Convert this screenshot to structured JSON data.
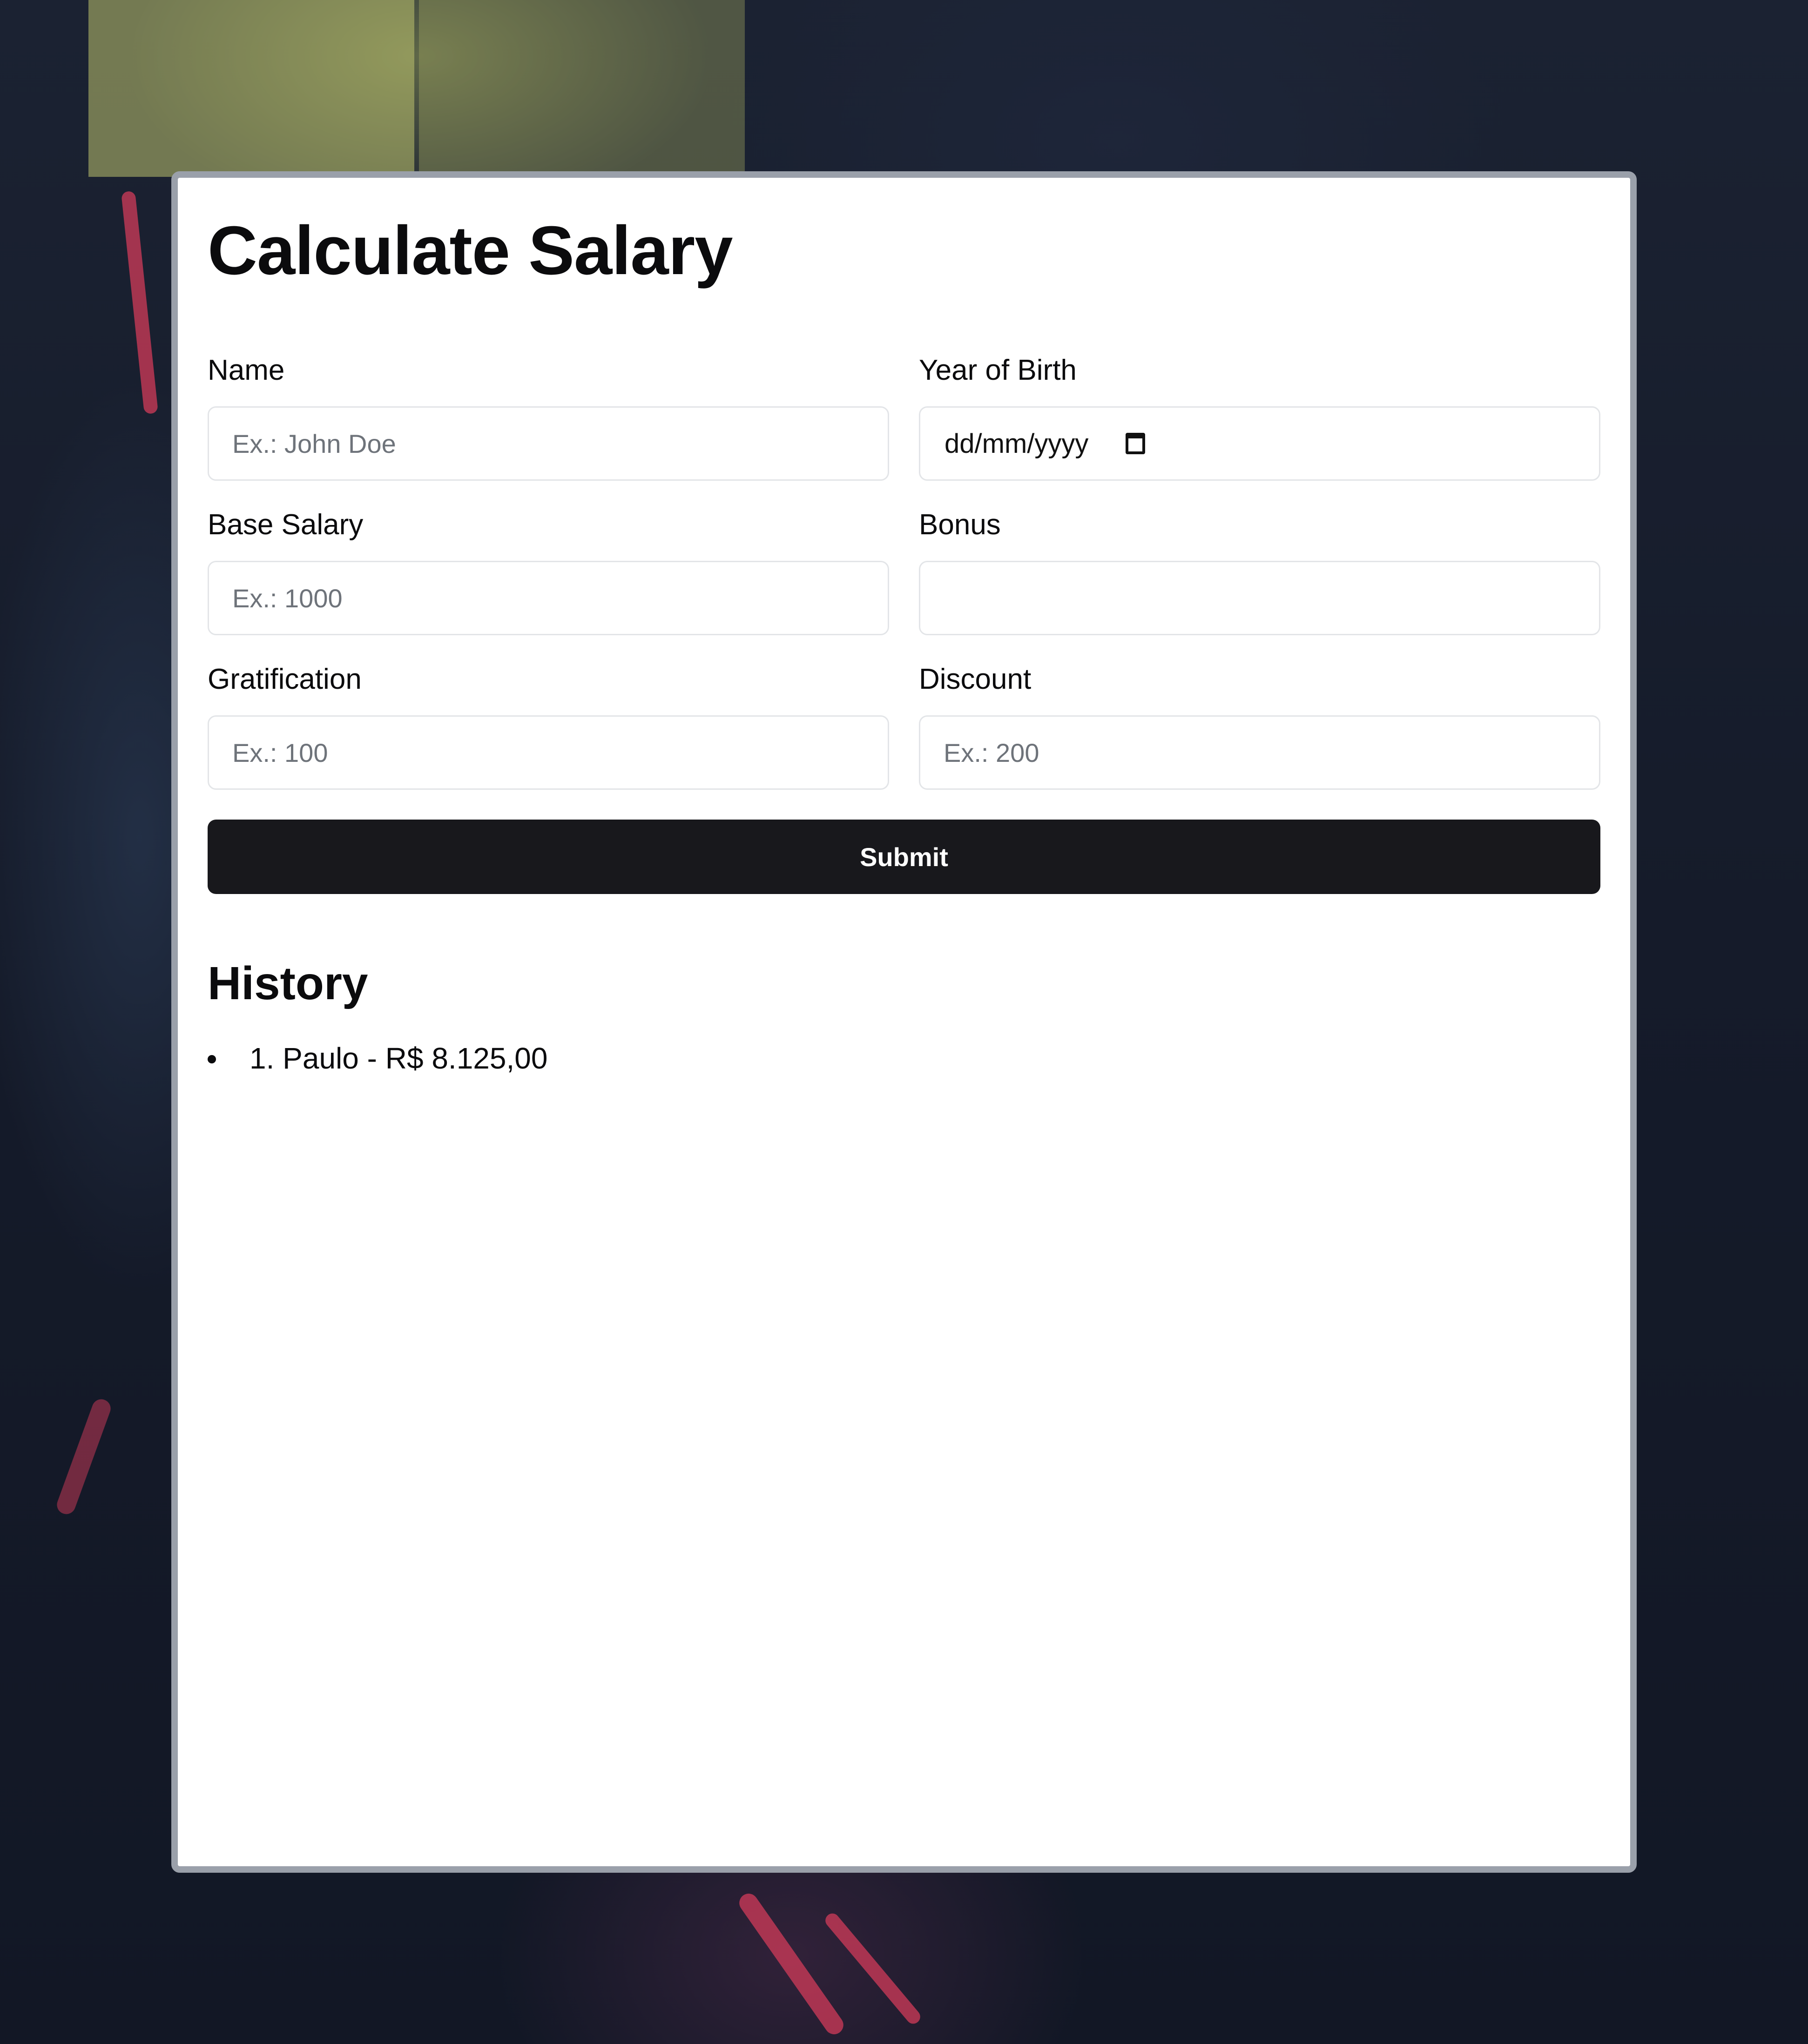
{
  "page": {
    "title": "Calculate Salary"
  },
  "form": {
    "name": {
      "label": "Name",
      "placeholder": "Ex.: John Doe",
      "value": ""
    },
    "year_of_birth": {
      "label": "Year of Birth",
      "placeholder": "dd/mm/yyyy",
      "icon": "calendar-icon"
    },
    "base_salary": {
      "label": "Base Salary",
      "placeholder": "Ex.: 1000",
      "value": ""
    },
    "bonus": {
      "label": "Bonus",
      "placeholder": "",
      "value": ""
    },
    "gratification": {
      "label": "Gratification",
      "placeholder": "Ex.: 100",
      "value": ""
    },
    "discount": {
      "label": "Discount",
      "placeholder": "Ex.: 200",
      "value": ""
    },
    "submit_label": "Submit"
  },
  "history": {
    "title": "History",
    "items": [
      "1. Paulo - R$ 8.125,00"
    ]
  },
  "colors": {
    "button_bg": "#18181c",
    "card_border": "#9aa0aa",
    "input_border": "#e3e5e8",
    "background": "#151a28"
  }
}
